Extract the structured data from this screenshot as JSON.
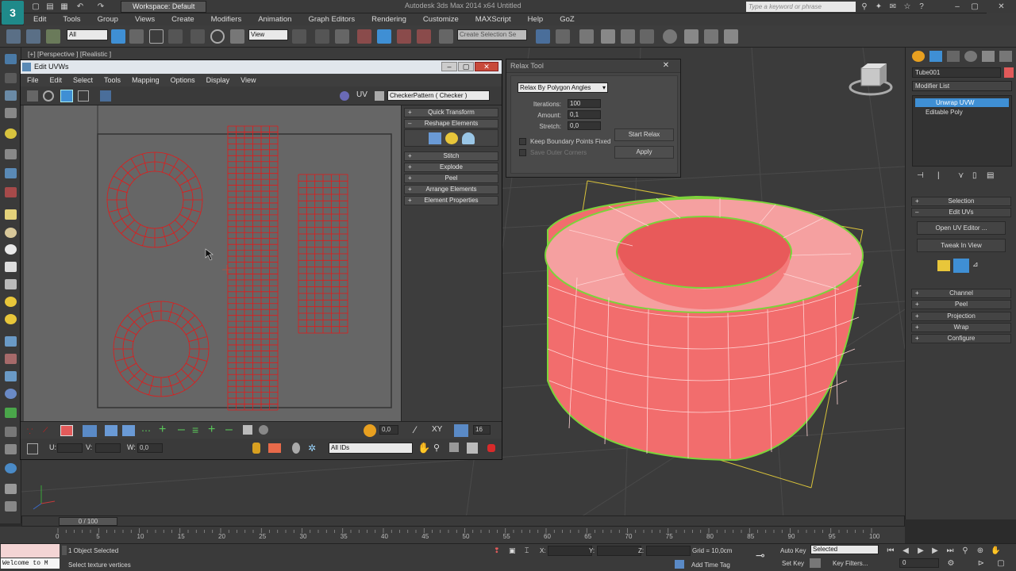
{
  "titlebar": {
    "workspace": "Workspace: Default",
    "app_title": "Autodesk 3ds Max 2014 x64    Untitled",
    "search_placeholder": "Type a keyword or phrase"
  },
  "menubar": [
    "Edit",
    "Tools",
    "Group",
    "Views",
    "Create",
    "Modifiers",
    "Animation",
    "Graph Editors",
    "Rendering",
    "Customize",
    "MAXScript",
    "Help",
    "GoZ"
  ],
  "toolbar": {
    "selection_filter": "All",
    "ref_coord": "View",
    "named_selection": "Create Selection Se"
  },
  "viewport": {
    "label": "[+] [Perspective ] [Realistic ]"
  },
  "uvw_editor": {
    "title": "Edit UVWs",
    "menu": [
      "File",
      "Edit",
      "Select",
      "Tools",
      "Mapping",
      "Options",
      "Display",
      "View"
    ],
    "uv_label": "UV",
    "checker_dropdown": "CheckerPattern  ( Checker )",
    "rollouts": {
      "quick_transform": "Quick Transform",
      "reshape": "Reshape Elements",
      "stitch": "Stitch",
      "explode": "Explode",
      "peel": "Peel",
      "arrange": "Arrange Elements",
      "element_props": "Element Properties"
    },
    "bottom": {
      "spinner_value": "0,0",
      "xy_label": "XY",
      "grid_value": "16",
      "u_label": "U:",
      "v_label": "V:",
      "w_label": "W:",
      "w_value": "0,0",
      "ids_dropdown": "All IDs"
    }
  },
  "relax_tool": {
    "title": "Relax Tool",
    "method": "Relax By Polygon Angles",
    "iterations_label": "Iterations:",
    "iterations": "100",
    "amount_label": "Amount:",
    "amount": "0,1",
    "stretch_label": "Stretch:",
    "stretch": "0,0",
    "keep_boundary": "Keep Boundary Points Fixed",
    "save_outer": "Save Outer Corners",
    "start_relax": "Start Relax",
    "apply": "Apply"
  },
  "command_panel": {
    "object_name": "Tube001",
    "modifier_list": "Modifier List",
    "stack": [
      "Unwrap UVW",
      "Editable Poly"
    ],
    "rollouts": {
      "selection": "Selection",
      "edit_uvs": "Edit UVs",
      "channel": "Channel",
      "peel": "Peel",
      "projection": "Projection",
      "wrap": "Wrap",
      "configure": "Configure"
    },
    "open_uv_editor": "Open UV Editor ...",
    "tweak_in_view": "Tweak In View"
  },
  "timeline": {
    "slider": "0 / 100",
    "ticks": [
      "0",
      "5",
      "10",
      "15",
      "20",
      "25",
      "30",
      "35",
      "40",
      "45",
      "50",
      "55",
      "60",
      "65",
      "70",
      "75",
      "80",
      "85",
      "90",
      "95",
      "100"
    ]
  },
  "status": {
    "welcome": "Welcome to M",
    "objects_selected": "1 Object Selected",
    "prompt": "Select texture vertices",
    "x_label": "X:",
    "y_label": "Y:",
    "z_label": "Z:",
    "grid": "Grid = 10,0cm",
    "add_time_tag": "Add Time Tag",
    "auto_key": "Auto Key",
    "set_key": "Set Key",
    "selected_dropdown": "Selected",
    "key_filters": "Key Filters...",
    "frame": "0"
  },
  "colors": {
    "uv_wire": "#e21a1a",
    "mesh": "#f26d6d",
    "mesh_edge": "#7bd43a",
    "title_bg": "#e1e6ec",
    "active_stack": "#3f8fd4"
  }
}
